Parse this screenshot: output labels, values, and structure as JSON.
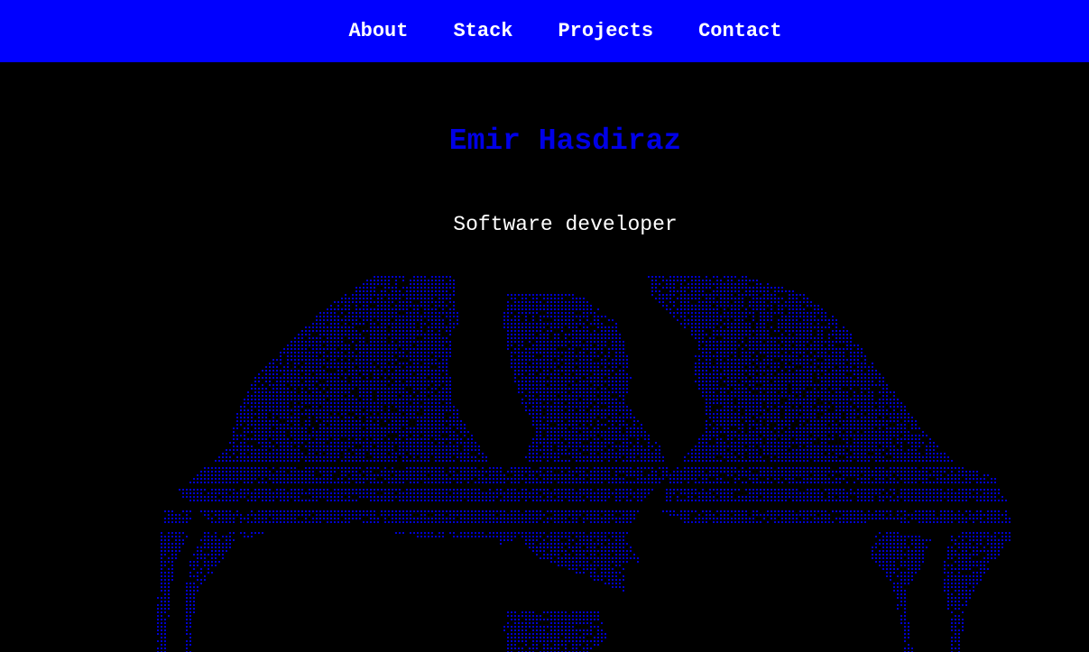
{
  "nav": {
    "items": [
      {
        "label": "About"
      },
      {
        "label": "Stack"
      },
      {
        "label": "Projects"
      },
      {
        "label": "Contact"
      }
    ]
  },
  "hero": {
    "name": "Emir Hasdiraz",
    "role": "Software developer"
  },
  "colors": {
    "nav_background": "#0000ff",
    "page_background": "#000000",
    "name_color": "#0000e6",
    "ascii_color": "#0000d0"
  },
  "art": {
    "icon": "ascii-eagle-icon"
  }
}
